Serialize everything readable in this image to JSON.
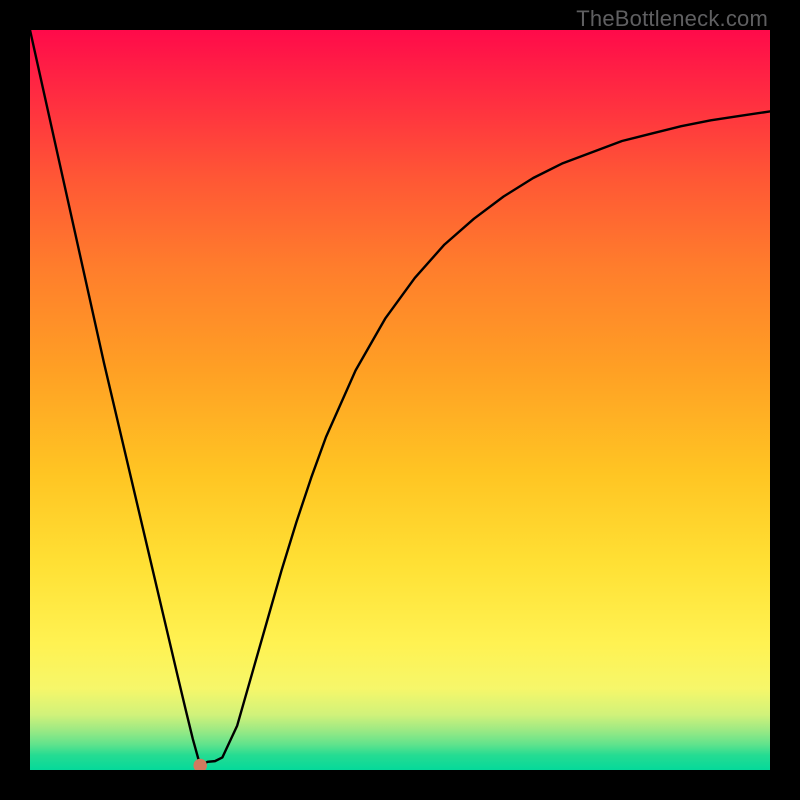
{
  "watermark": {
    "text": "TheBottleneck.com"
  },
  "chart_data": {
    "type": "line",
    "title": "",
    "xlabel": "",
    "ylabel": "",
    "xlim": [
      0,
      100
    ],
    "ylim": [
      0,
      100
    ],
    "grid": false,
    "background": "thermal-gradient",
    "marker": {
      "x": 23,
      "y": 0.6,
      "color": "#d07b5f"
    },
    "series": [
      {
        "name": "curve",
        "color": "#000000",
        "x": [
          0,
          2,
          4,
          6,
          8,
          10,
          12,
          14,
          16,
          18,
          20,
          21,
          22,
          23,
          24,
          25,
          26,
          28,
          30,
          32,
          34,
          36,
          38,
          40,
          44,
          48,
          52,
          56,
          60,
          64,
          68,
          72,
          76,
          80,
          84,
          88,
          92,
          96,
          100
        ],
        "y": [
          100,
          91,
          82,
          73,
          64,
          55,
          46.5,
          38,
          29.5,
          21,
          12.5,
          8.3,
          4.2,
          0.6,
          1.1,
          1.2,
          1.7,
          6,
          13,
          20,
          27,
          33.5,
          39.5,
          45,
          54,
          61,
          66.5,
          71,
          74.5,
          77.5,
          80,
          82,
          83.5,
          85,
          86,
          87,
          87.8,
          88.4,
          89
        ]
      }
    ]
  }
}
